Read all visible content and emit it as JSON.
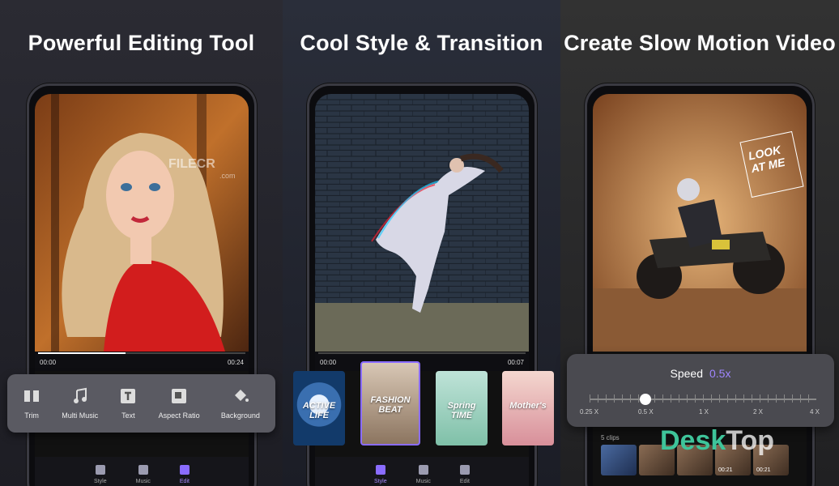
{
  "panels": [
    {
      "headline": "Powerful Editing Tool"
    },
    {
      "headline": "Cool Style & Transition"
    },
    {
      "headline": "Create Slow Motion Video"
    }
  ],
  "editor": {
    "time_start": "00:00",
    "time_end": "00:24",
    "progress": 0.42,
    "tools": [
      "Trim",
      "Multi Music",
      "Text",
      "Aspect Ratio",
      "Background"
    ]
  },
  "style": {
    "time_start": "00:00",
    "time_end": "00:07",
    "cards": [
      "ACTIVE LIFE",
      "FASHION BEAT",
      "Spring TIME",
      "Mother's"
    ]
  },
  "nav": {
    "items": [
      "Style",
      "Music",
      "Edit"
    ]
  },
  "slowmo": {
    "speed_label": "Speed",
    "speed_value": "0.5x",
    "scale_labels": [
      "0.25 X",
      "0.5 X",
      "1 X",
      "2 X",
      "4 X"
    ],
    "clips_label": "5 clips",
    "clip_times": [
      "00:21",
      "00:21"
    ],
    "sticker_text": "LOOK AT ME"
  },
  "watermarks": {
    "filecr": "FILECR",
    "filecr_sub": ".com",
    "desktop_prefix": "Desk",
    "desktop_suffix": "Top"
  },
  "colors": {
    "accent": "#8a6cff",
    "speed_value": "#9f86ff"
  }
}
